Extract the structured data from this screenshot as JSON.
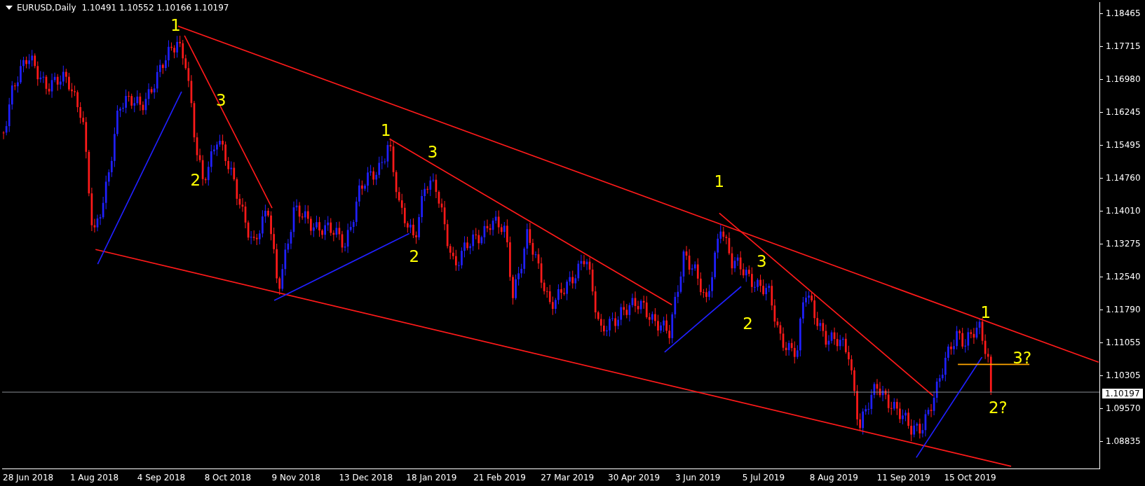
{
  "chart": {
    "header": {
      "symbol": "EURUSD,Daily",
      "quote": "1.10491 1.10552 1.10166 1.10197"
    },
    "wave_labels": [
      "1",
      "3",
      "2",
      "1",
      "3",
      "2",
      "1",
      "3",
      "2",
      "1",
      "3?",
      "2?"
    ],
    "price_axis": [
      "1.18465",
      "1.17715",
      "1.16980",
      "1.16245",
      "1.15495",
      "1.14760",
      "1.14010",
      "1.13275",
      "1.12540",
      "1.11790",
      "1.11055",
      "1.10305",
      "1.09570",
      "1.08835"
    ],
    "current_price": "1.10197",
    "date_axis": [
      "28 Jun 2018",
      "1 Aug 2018",
      "4 Sep 2018",
      "8 Oct 2018",
      "9 Nov 2018",
      "13 Dec 2018",
      "18 Jan 2019",
      "21 Feb 2019",
      "27 Mar 2019",
      "30 Apr 2019",
      "3 Jun 2019",
      "5 Jul 2019",
      "8 Aug 2019",
      "11 Sep 2019",
      "15 Oct 2019"
    ]
  }
}
